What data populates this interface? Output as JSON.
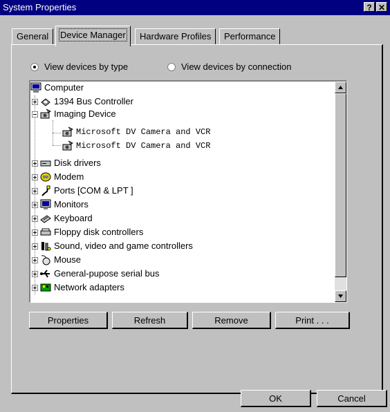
{
  "window": {
    "title": "System Properties",
    "help_glyph": "?",
    "close_glyph": "✕"
  },
  "tabs": [
    {
      "label": "General"
    },
    {
      "label": "Device Manager"
    },
    {
      "label": "Hardware Profiles"
    },
    {
      "label": "Performance"
    }
  ],
  "view_options": {
    "by_type": {
      "label": "View devices by type",
      "selected": true
    },
    "by_connection": {
      "label": "View devices by connection",
      "selected": false
    }
  },
  "device_tree": {
    "root": {
      "label": "Computer",
      "icon": "computer-icon"
    },
    "items": [
      {
        "label": "1394 Bus Controller",
        "icon": "bus-controller-icon",
        "expanded": false
      },
      {
        "label": "Imaging Device",
        "icon": "camera-icon",
        "expanded": true,
        "children": [
          {
            "label": "Microsoft DV Camera and VCR",
            "icon": "camera-icon"
          },
          {
            "label": "Microsoft DV Camera and VCR",
            "icon": "camera-icon"
          }
        ]
      },
      {
        "label": "Disk drivers",
        "icon": "disk-drive-icon",
        "expanded": false
      },
      {
        "label": "Modem",
        "icon": "modem-icon",
        "expanded": false
      },
      {
        "label": "Ports [COM & LPT ]",
        "icon": "port-icon",
        "expanded": false
      },
      {
        "label": "Monitors",
        "icon": "monitor-icon",
        "expanded": false
      },
      {
        "label": "Keyboard",
        "icon": "keyboard-icon",
        "expanded": false
      },
      {
        "label": "Floppy disk controllers",
        "icon": "floppy-controller-icon",
        "expanded": false
      },
      {
        "label": "Sound, video and game controllers",
        "icon": "sound-controller-icon",
        "expanded": false
      },
      {
        "label": "Mouse",
        "icon": "mouse-icon",
        "expanded": false
      },
      {
        "label": "General-pupose  serial bus",
        "icon": "usb-icon",
        "expanded": false
      },
      {
        "label": "Network adapters",
        "icon": "network-adapter-icon",
        "expanded": false
      }
    ]
  },
  "buttons": {
    "properties": "Properties",
    "refresh": "Refresh",
    "remove": "Remove",
    "print": "Print . . .",
    "ok": "OK",
    "cancel": "Cancel"
  },
  "colors": {
    "titlebar": "#000080",
    "face": "#c0c0c0"
  }
}
